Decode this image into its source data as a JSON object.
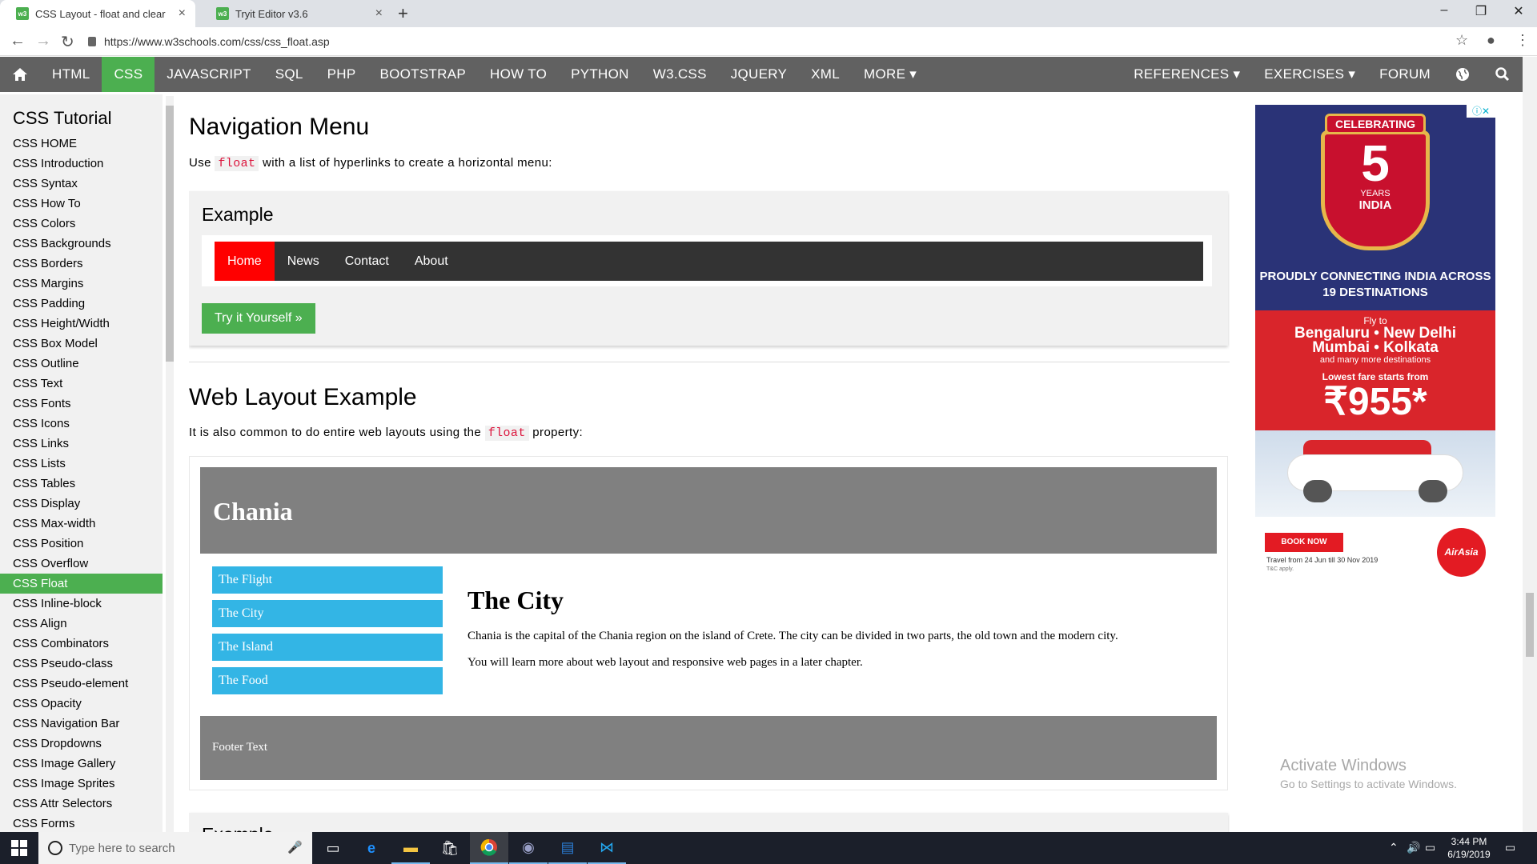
{
  "browser": {
    "tabs": [
      {
        "title": "CSS Layout - float and clear",
        "favicon": "w3"
      },
      {
        "title": "Tryit Editor v3.6",
        "favicon": "w3"
      }
    ],
    "url": "https://www.w3schools.com/css/css_float.asp"
  },
  "topnav": {
    "items": [
      "HTML",
      "CSS",
      "JAVASCRIPT",
      "SQL",
      "PHP",
      "BOOTSTRAP",
      "HOW TO",
      "PYTHON",
      "W3.CSS",
      "JQUERY",
      "XML",
      "MORE ▾"
    ],
    "active": "CSS",
    "right": [
      "REFERENCES ▾",
      "EXERCISES ▾",
      "FORUM"
    ]
  },
  "sidebar": {
    "title": "CSS Tutorial",
    "items": [
      "CSS HOME",
      "CSS Introduction",
      "CSS Syntax",
      "CSS How To",
      "CSS Colors",
      "CSS Backgrounds",
      "CSS Borders",
      "CSS Margins",
      "CSS Padding",
      "CSS Height/Width",
      "CSS Box Model",
      "CSS Outline",
      "CSS Text",
      "CSS Fonts",
      "CSS Icons",
      "CSS Links",
      "CSS Lists",
      "CSS Tables",
      "CSS Display",
      "CSS Max-width",
      "CSS Position",
      "CSS Overflow",
      "CSS Float",
      "CSS Inline-block",
      "CSS Align",
      "CSS Combinators",
      "CSS Pseudo-class",
      "CSS Pseudo-element",
      "CSS Opacity",
      "CSS Navigation Bar",
      "CSS Dropdowns",
      "CSS Image Gallery",
      "CSS Image Sprites",
      "CSS Attr Selectors",
      "CSS Forms"
    ],
    "active": "CSS Float"
  },
  "main": {
    "nav_section": {
      "title": "Navigation Menu",
      "intro_pre": "Use ",
      "intro_code": "float",
      "intro_post": " with a list of hyperlinks to create a horizontal menu:",
      "example_title": "Example",
      "demo_menu": [
        "Home",
        "News",
        "Contact",
        "About"
      ],
      "try_button": "Try it Yourself »"
    },
    "layout_section": {
      "title": "Web Layout Example",
      "intro_pre": "It is also common to do entire web layouts using the ",
      "intro_code": "float",
      "intro_post": " property:",
      "header": "Chania",
      "menu": [
        "The Flight",
        "The City",
        "The Island",
        "The Food"
      ],
      "content_title": "The City",
      "paragraphs": [
        "Chania is the capital of the Chania region on the island of Crete. The city can be divided in two parts, the old town and the modern city.",
        "You will learn more about web layout and responsive web pages in a later chapter."
      ],
      "footer": "Footer Text"
    },
    "next_example_title": "Example"
  },
  "ad": {
    "badge_top": "CELEBRATING",
    "badge_number": "5",
    "badge_years": "YEARS",
    "badge_country": "INDIA",
    "tagline": "PROUDLY CONNECTING INDIA ACROSS 19 DESTINATIONS",
    "fly_to": "Fly to",
    "cities_1": "Bengaluru • New Delhi",
    "cities_2": "Mumbai • Kolkata",
    "more_dest": "and many more destinations",
    "fare_label": "Lowest fare starts from",
    "price": "₹955*",
    "book_now": "BOOK NOW",
    "travel_dates": "Travel from 24 Jun till 30 Nov 2019",
    "tc": "T&C apply.",
    "brand": "AirAsia"
  },
  "watermark": {
    "line1": "Activate Windows",
    "line2": "Go to Settings to activate Windows."
  },
  "taskbar": {
    "search_placeholder": "Type here to search",
    "time": "3:44 PM",
    "date": "6/19/2019"
  },
  "colors": {
    "w3_green": "#4caf50",
    "topnav_bg": "#616161",
    "demo_nav_bg": "#333333",
    "demo_active": "#ff0000",
    "layout_grey": "#808080",
    "layout_menu": "#33b5e5",
    "code_red": "#dc143c"
  }
}
